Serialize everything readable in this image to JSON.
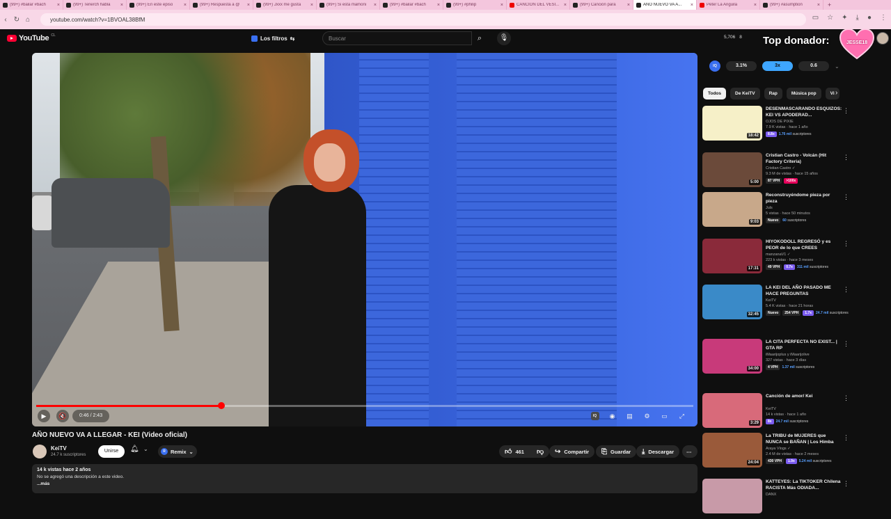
{
  "browser": {
    "tabs": [
      {
        "label": "(99+) #bailar #bach",
        "active": false
      },
      {
        "label": "(99+) Tenerch habla",
        "active": false
      },
      {
        "label": "(99+) En este episo",
        "active": false
      },
      {
        "label": "(99+) Respuesta a @",
        "active": false
      },
      {
        "label": "(99+) Jxxx me gusta",
        "active": false
      },
      {
        "label": "(99+) Si esta mamoni",
        "active": false
      },
      {
        "label": "(99+) #bailar #bach",
        "active": false
      },
      {
        "label": "(99+) #philip",
        "active": false
      },
      {
        "label": "CANCIÓN DEL VESI...",
        "active": false
      },
      {
        "label": "(99+) Canción para",
        "active": false
      },
      {
        "label": "AÑO NUEVO VA A...",
        "active": true
      },
      {
        "label": "Peter La Anguila",
        "active": false
      },
      {
        "label": "(99+) #asumption",
        "active": false
      }
    ],
    "url": "youtube.com/watch?v=1BVOAL38BfM"
  },
  "header": {
    "logo_text": "YouTube",
    "country": "CL",
    "filters_label": "Los filtros",
    "search_placeholder": "Buscar",
    "stats": [
      "5,706",
      "8"
    ],
    "donor_text": "Top donador:",
    "donor_name": "JESSE18"
  },
  "player": {
    "current_time": "0:46",
    "duration": "2:43",
    "time_display": "0:46 / 2:43",
    "progress": 0.2822,
    "accent_color": "#ff0000"
  },
  "video": {
    "title": "AÑO NUEVO VA A LLEGAR - KEI (Video oficial)",
    "channel": "KeiTV",
    "subscribers": "24.7 k suscriptores",
    "join_label": "Unirse",
    "remix_label": "Remix",
    "likes": "461",
    "share_label": "Compartir",
    "save_label": "Guardar",
    "download_label": "Descargar",
    "views_date": "14 k vistas  hace 2 años",
    "description": "No se agregó una descripción a este video.",
    "more_label": "...más"
  },
  "sidebar": {
    "speeds": [
      {
        "label": "3.1%",
        "active": false
      },
      {
        "label": "3x",
        "active": true
      },
      {
        "label": "0.6",
        "active": false
      }
    ],
    "chips": [
      {
        "label": "Todos",
        "active": true
      },
      {
        "label": "De KeiTV",
        "active": false
      },
      {
        "label": "Rap",
        "active": false
      },
      {
        "label": "Música pop",
        "active": false
      },
      {
        "label": "Vi",
        "active": false
      }
    ],
    "recommendations": [
      {
        "title": "DESENMASCARANDO ESQUIZOS: KEI VS APODERAD...",
        "channel": "OJOS DE PIXIE",
        "meta": "7.9 K vistas · hace 1 año",
        "duration": "18:42",
        "badges": [
          "8.8x"
        ],
        "subs": "1.76 mil",
        "thumb_color": "#f6f0c8"
      },
      {
        "title": "Cristian Castro - Volcán (Hit Factory Criteria)",
        "channel": "Cristian Castro ✓",
        "meta": "9.3 M de vistas · hace 15 años",
        "duration": "5:00",
        "badges": [
          "87 VPH",
          ">100x"
        ],
        "subs": "",
        "thumb_color": "#6b4a3a"
      },
      {
        "title": "Reconstruyéndome pieza por pieza",
        "channel": "Juls",
        "meta": "5 vistas · hace 50 minutos",
        "duration": "9:03",
        "badges": [
          "Nuevo"
        ],
        "subs": "60",
        "thumb_color": "#c8a88a"
      },
      {
        "title": "HIYOKODOLL REGRESÓ y es PEOR de lo que CREES",
        "channel": "manzanaV1 ✓",
        "meta": "223 k vistas · hace 3 meses",
        "duration": "17:31",
        "badges": [
          "49 VPH",
          "0.7x"
        ],
        "subs": "311 mil",
        "thumb_color": "#8a2a3a"
      },
      {
        "title": "LA KEI DEL AÑO PASADO ME HACE PREGUNTAS",
        "channel": "KeiTV",
        "meta": "5.4 K vistas · hace 21 horas",
        "duration": "32:45",
        "badges": [
          "Nuevo",
          "254 VPH",
          "1.7x"
        ],
        "subs": "24.7 mil",
        "thumb_color": "#3a8ac8"
      },
      {
        "title": "LA CITA PERFECTA NO EXIST... | GTA RP",
        "channel": "iMaarijoplus y iMaarijolive",
        "meta": "327 vistas · hace 3 días",
        "duration": "34:00",
        "badges": [
          "4 VPH"
        ],
        "subs": "1.37 mil",
        "thumb_color": "#c83a7a"
      },
      {
        "title": "Canción de amor/ Kei",
        "channel": "KeiTV",
        "meta": "14 k vistas · hace 1 año",
        "duration": "3:29",
        "badges": [
          "8x"
        ],
        "subs": "24.7 mil",
        "thumb_color": "#d86a7a"
      },
      {
        "title": "La TRIBU de MUJERES que NUNCA se BAÑAN | Los Himba",
        "channel": "Araya Vlogs ✓",
        "meta": "2.4 M de vistas · hace 2 meses",
        "duration": "24:04",
        "badges": [
          "430 VPH",
          "1.9x"
        ],
        "subs": "5.24 mil",
        "thumb_color": "#9a5a3a"
      },
      {
        "title": "KATTEYES: La TIKTOKER Chilena RACISTA Más ODIADA...",
        "channel": "DANX",
        "meta": "",
        "duration": "",
        "badges": [],
        "subs": "",
        "thumb_color": "#c89aa8"
      }
    ]
  }
}
